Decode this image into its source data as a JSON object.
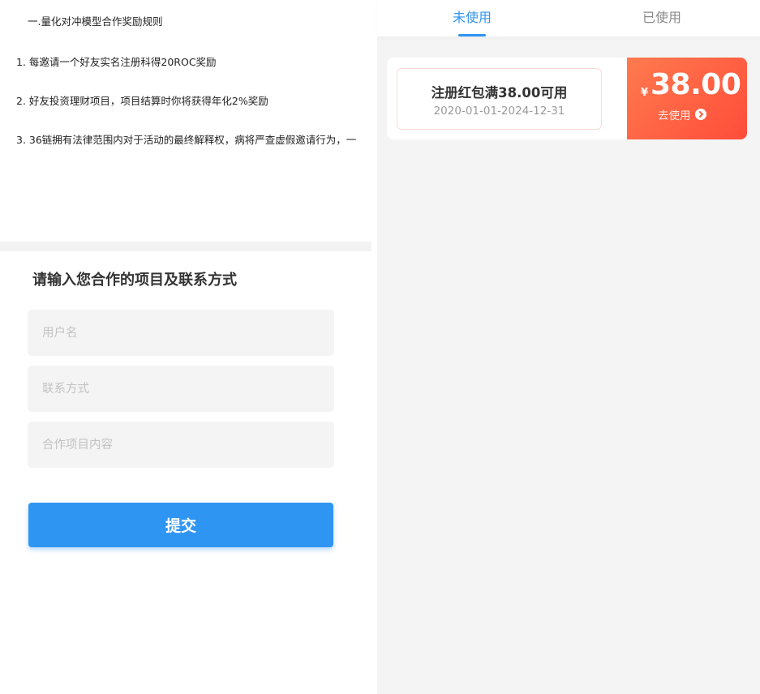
{
  "rules": {
    "title": "一.量化对冲模型合作奖励规则",
    "items": [
      "1. 每邀请一个好友实名注册科得20ROC奖励",
      "2. 好友投资理财项目，项目结算时你将获得年化2%奖励",
      "3. 36链拥有法律范围内对于活动的最终解释权，病将严查虚假邀请行为，一"
    ]
  },
  "form": {
    "title": "请输入您合作的项目及联系方式",
    "username_placeholder": "用户名",
    "contact_placeholder": "联系方式",
    "project_placeholder": "合作项目内容",
    "submit_label": "提交"
  },
  "tabs": {
    "unused_label": "未使用",
    "used_label": "已使用",
    "active": "unused",
    "active_color": "#2f95f3"
  },
  "coupon": {
    "name": "注册红包满38.00可用",
    "date_range": "2020-01-01-2024-12-31",
    "currency_symbol": "¥",
    "amount": "38.00",
    "action_label": "去使用",
    "action_icon": "chevron-right-circle-icon",
    "stub_color": "#ff5a3d"
  }
}
